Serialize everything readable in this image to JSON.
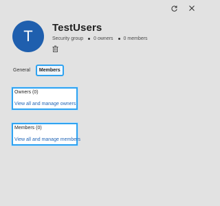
{
  "window": {
    "refresh_icon": "refresh-icon",
    "close_icon": "close-icon"
  },
  "group": {
    "avatar_initial": "T",
    "name": "TestUsers",
    "type": "Security group",
    "owners_count": "0 owners",
    "members_count": "0 members"
  },
  "tabs": [
    {
      "label": "General",
      "active": false
    },
    {
      "label": "Members",
      "active": true
    }
  ],
  "cards": {
    "owners": {
      "title": "Owners (0)",
      "link": "View all and manage owners"
    },
    "members": {
      "title": "Members (0)",
      "link": "View all and manage members"
    }
  },
  "colors": {
    "avatar": "#1f5fae",
    "focus": "#2ea2f0",
    "link": "#1e63b5",
    "background": "#e2e2e2"
  }
}
